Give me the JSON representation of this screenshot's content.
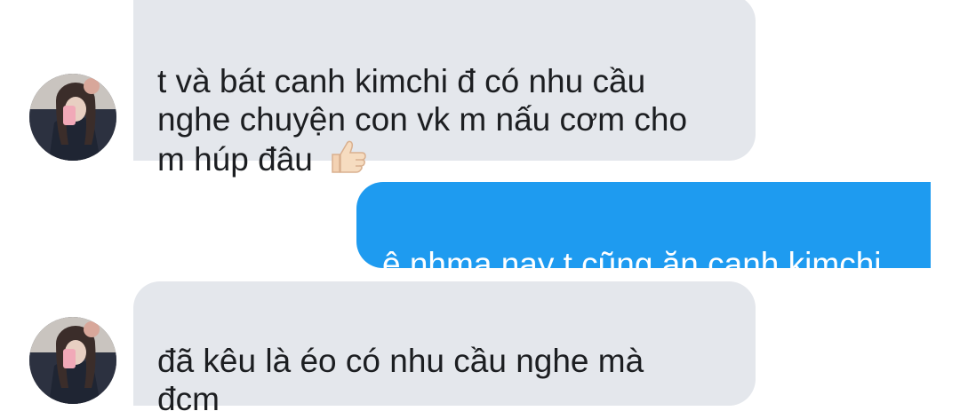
{
  "messages": [
    {
      "direction": "incoming",
      "text": "t và bát canh kimchi đ có nhu cầu\nnghe chuyện con vk m nấu cơm cho\nm húp đâu ",
      "trailing_icon": "thumbs-up-emoji"
    },
    {
      "direction": "outgoing",
      "text": "ê nhma nay t cũng ăn canh kimchi"
    },
    {
      "direction": "incoming",
      "text": "đã kêu là éo có nhu cầu nghe mà\nđcm"
    }
  ],
  "colors": {
    "incoming_bubble": "#e4e7ec",
    "outgoing_bubble": "#1e9bf0",
    "incoming_text": "#1c1e21",
    "outgoing_text": "#ffffff"
  },
  "icons": {
    "avatar": "sender-avatar",
    "reaction": "thumbs-up-icon"
  }
}
